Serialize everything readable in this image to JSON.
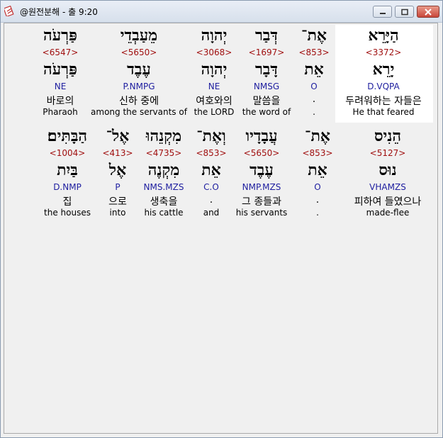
{
  "window": {
    "title": "@원전분해 - 출 9:20"
  },
  "rows": [
    [
      {
        "heb": "פַּרְעֹה",
        "strong": "<6547>",
        "lemma": "פַּרְעֹה",
        "morph": "NE",
        "kor": "바로의",
        "eng": "Pharaoh"
      },
      {
        "heb": "מֵעַבְדֵי",
        "strong": "<5650>",
        "lemma": "עֶבֶד",
        "morph": "P.NMPG",
        "kor": "신하 중에",
        "eng": "among the servants of"
      },
      {
        "heb": "יְהוָה",
        "strong": "<3068>",
        "lemma": "יְהוָה",
        "morph": "NE",
        "kor": "여호와의",
        "eng": "the LORD"
      },
      {
        "heb": "דְּבַר",
        "strong": "<1697>",
        "lemma": "דָּבָר",
        "morph": "NMSG",
        "kor": "말씀을",
        "eng": "the word of"
      },
      {
        "heb": "אֶת־",
        "strong": "<853>",
        "lemma": "אֵת",
        "morph": "O",
        "kor": ".",
        "eng": "."
      },
      {
        "heb": "הַיָּרֵא",
        "strong": "<3372>",
        "lemma": "יָרֵא",
        "morph": "D.VQPA",
        "kor": "두려워하는 자들은",
        "eng": "He that feared"
      }
    ],
    [
      {
        "heb": "הַבָּתִּים׃",
        "strong": "<1004>",
        "lemma": "בַּיִת",
        "morph": "D.NMP",
        "kor": "집",
        "eng": "the houses"
      },
      {
        "heb": "אֶל־",
        "strong": "<413>",
        "lemma": "אֶל",
        "morph": "P",
        "kor": "으로",
        "eng": "into"
      },
      {
        "heb": "מִקְנֵהוּ",
        "strong": "<4735>",
        "lemma": "מִקְנֶה",
        "morph": "NMS.MZS",
        "kor": "생축을",
        "eng": "his cattle"
      },
      {
        "heb": "וְאֶת־",
        "strong": "<853>",
        "lemma": "אֵת",
        "morph": "C.O",
        "kor": ".",
        "eng": "and"
      },
      {
        "heb": "עֲבָדָיו",
        "strong": "<5650>",
        "lemma": "עֶבֶד",
        "morph": "NMP.MZS",
        "kor": "그 종들과",
        "eng": "his servants"
      },
      {
        "heb": "אֶת־",
        "strong": "<853>",
        "lemma": "אֵת",
        "morph": "O",
        "kor": ".",
        "eng": "."
      },
      {
        "heb": "הֵנִיס",
        "strong": "<5127>",
        "lemma": "נוּס",
        "morph": "VHAMZS",
        "kor": "피하여 들였으나",
        "eng": "made-flee"
      }
    ]
  ],
  "colors": {
    "strong": "#a01010",
    "morph": "#2020a0",
    "highlight": "#ffffff"
  }
}
